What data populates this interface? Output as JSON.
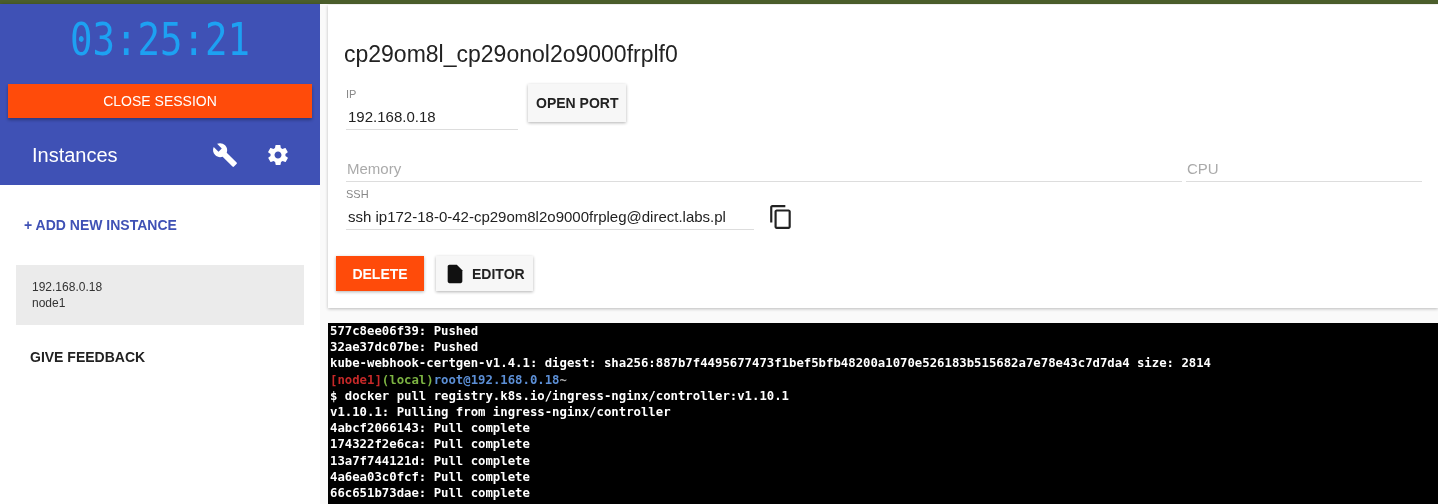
{
  "sidebar": {
    "timer": "03:25:21",
    "close_button": "CLOSE SESSION",
    "title": "Instances",
    "add_instance": "+ ADD NEW INSTANCE",
    "instances": [
      {
        "ip": "192.168.0.18",
        "name": "node1",
        "selected": true
      }
    ],
    "feedback": "GIVE FEEDBACK"
  },
  "instance": {
    "title": "cp29om8l_cp29onol2o9000frplf0",
    "ip": {
      "label": "IP",
      "value": "192.168.0.18"
    },
    "open_port": "OPEN PORT",
    "memory": {
      "placeholder": "Memory"
    },
    "cpu": {
      "placeholder": "CPU"
    },
    "ssh": {
      "label": "SSH",
      "value": "ssh ip172-18-0-42-cp29om8l2o9000frpleg@direct.labs.pl"
    },
    "delete": "DELETE",
    "editor": "EDITOR"
  },
  "terminal": {
    "lines": [
      [
        {
          "text": "577c8ee06f39: Pushed",
          "color": "#ffffff"
        }
      ],
      [
        {
          "text": "32ae37dc07be: Pushed",
          "color": "#ffffff"
        }
      ],
      [
        {
          "text": "kube-webhook-certgen-v1.4.1: digest: sha256:887b7f4495677473f1bef5bfb48200a1070e526183b515682a7e78e43c7d7da4 size: 2814",
          "color": "#ffffff"
        }
      ],
      [
        {
          "text": "[node1]",
          "color": "#c62828"
        },
        {
          "text": "(local)",
          "color": "#7cb342"
        },
        {
          "text": "root@192.168.0.18",
          "color": "#5c8fd6"
        },
        {
          "text": "~",
          "color": "#b0b0b0"
        }
      ],
      [
        {
          "text": "$ docker pull registry.k8s.io/ingress-nginx/controller:v1.10.1",
          "color": "#ffffff"
        }
      ],
      [
        {
          "text": "v1.10.1: Pulling from ingress-nginx/controller",
          "color": "#ffffff"
        }
      ],
      [
        {
          "text": "4abcf2066143: Pull complete",
          "color": "#ffffff"
        }
      ],
      [
        {
          "text": "174322f2e6ca: Pull complete",
          "color": "#ffffff"
        }
      ],
      [
        {
          "text": "13a7f744121d: Pull complete",
          "color": "#ffffff"
        }
      ],
      [
        {
          "text": "4a6ea03c0fcf: Pull complete",
          "color": "#ffffff"
        }
      ],
      [
        {
          "text": "66c651b73dae: Pull complete",
          "color": "#ffffff"
        }
      ]
    ]
  }
}
